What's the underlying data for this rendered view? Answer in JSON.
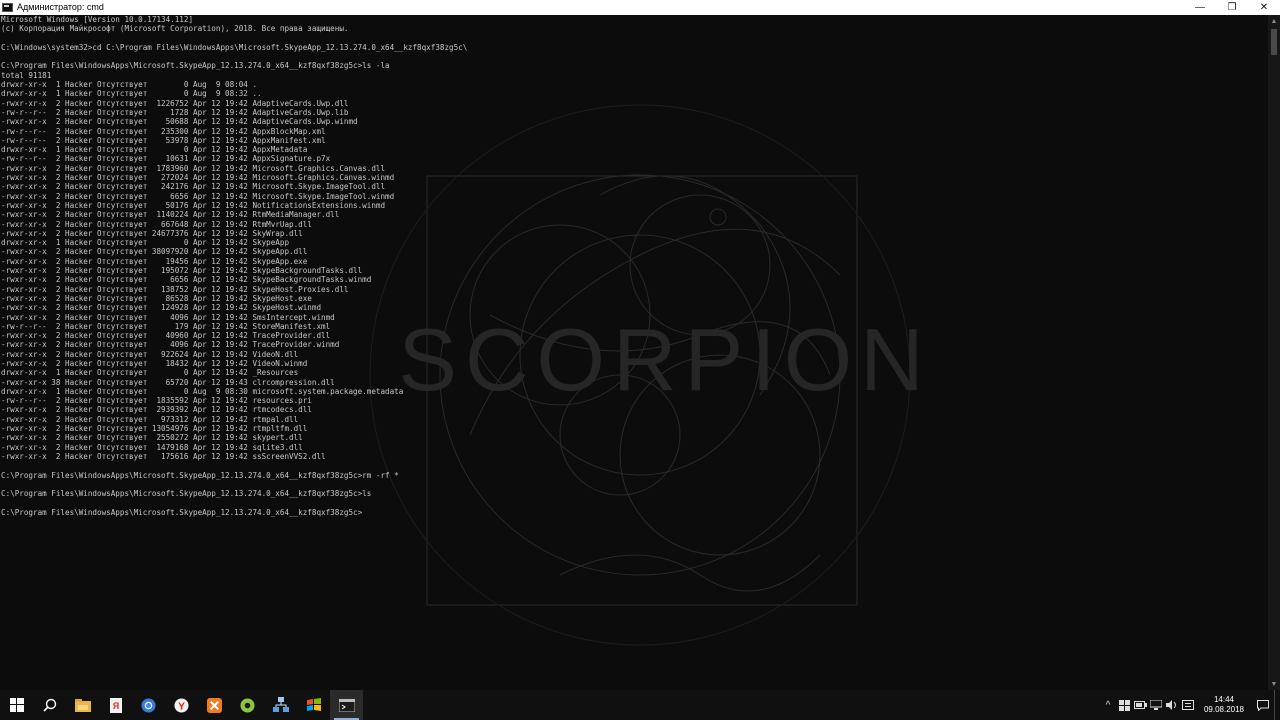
{
  "window": {
    "title": "Администратор: cmd",
    "min_glyph": "—",
    "max_glyph": "❐",
    "close_glyph": "✕"
  },
  "wallpaper": {
    "text": "SCORPION"
  },
  "console": {
    "lines": [
      "Microsoft Windows [Version 10.0.17134.112]",
      "(c) Корпорация Майкрософт (Microsoft Corporation), 2018. Все права защищены.",
      "",
      "C:\\Windows\\system32>cd C:\\Program Files\\WindowsApps\\Microsoft.SkypeApp_12.13.274.0_x64__kzf8qxf38zg5c\\",
      "",
      "C:\\Program Files\\WindowsApps\\Microsoft.SkypeApp_12.13.274.0_x64__kzf8qxf38zg5c>ls -la",
      "total 91181",
      "drwxr-xr-x  1 Hacker Отсутствует        0 Aug  9 08:04 .",
      "drwxr-xr-x  1 Hacker Отсутствует        0 Aug  9 08:32 ..",
      "-rwxr-xr-x  2 Hacker Отсутствует  1226752 Apr 12 19:42 AdaptiveCards.Uwp.dll",
      "-rw-r--r--  2 Hacker Отсутствует     1728 Apr 12 19:42 AdaptiveCards.Uwp.lib",
      "-rwxr-xr-x  2 Hacker Отсутствует    50688 Apr 12 19:42 AdaptiveCards.Uwp.winmd",
      "-rw-r--r--  2 Hacker Отсутствует   235300 Apr 12 19:42 AppxBlockMap.xml",
      "-rw-r--r--  2 Hacker Отсутствует    53978 Apr 12 19:42 AppxManifest.xml",
      "drwxr-xr-x  1 Hacker Отсутствует        0 Apr 12 19:42 AppxMetadata",
      "-rw-r--r--  2 Hacker Отсутствует    10631 Apr 12 19:42 AppxSignature.p7x",
      "-rwxr-xr-x  2 Hacker Отсутствует  1783960 Apr 12 19:42 Microsoft.Graphics.Canvas.dll",
      "-rwxr-xr-x  2 Hacker Отсутствует   272024 Apr 12 19:42 Microsoft.Graphics.Canvas.winmd",
      "-rwxr-xr-x  2 Hacker Отсутствует   242176 Apr 12 19:42 Microsoft.Skype.ImageTool.dll",
      "-rwxr-xr-x  2 Hacker Отсутствует     6656 Apr 12 19:42 Microsoft.Skype.ImageTool.winmd",
      "-rwxr-xr-x  2 Hacker Отсутствует    50176 Apr 12 19:42 NotificationsExtensions.winmd",
      "-rwxr-xr-x  2 Hacker Отсутствует  1140224 Apr 12 19:42 RtmMediaManager.dll",
      "-rwxr-xr-x  2 Hacker Отсутствует   667648 Apr 12 19:42 RtmMvrUap.dll",
      "-rwxr-xr-x  2 Hacker Отсутствует 24677376 Apr 12 19:42 SkyWrap.dll",
      "drwxr-xr-x  1 Hacker Отсутствует        0 Apr 12 19:42 SkypeApp",
      "-rwxr-xr-x  2 Hacker Отсутствует 38097920 Apr 12 19:42 SkypeApp.dll",
      "-rwxr-xr-x  2 Hacker Отсутствует    19456 Apr 12 19:42 SkypeApp.exe",
      "-rwxr-xr-x  2 Hacker Отсутствует   195072 Apr 12 19:42 SkypeBackgroundTasks.dll",
      "-rwxr-xr-x  2 Hacker Отсутствует     6656 Apr 12 19:42 SkypeBackgroundTasks.winmd",
      "-rwxr-xr-x  2 Hacker Отсутствует   138752 Apr 12 19:42 SkypeHost.Proxies.dll",
      "-rwxr-xr-x  2 Hacker Отсутствует    86528 Apr 12 19:42 SkypeHost.exe",
      "-rwxr-xr-x  2 Hacker Отсутствует   124928 Apr 12 19:42 SkypeHost.winmd",
      "-rwxr-xr-x  2 Hacker Отсутствует     4096 Apr 12 19:42 SmsIntercept.winmd",
      "-rw-r--r--  2 Hacker Отсутствует      179 Apr 12 19:42 StoreManifest.xml",
      "-rwxr-xr-x  2 Hacker Отсутствует    40960 Apr 12 19:42 TraceProvider.dll",
      "-rwxr-xr-x  2 Hacker Отсутствует     4096 Apr 12 19:42 TraceProvider.winmd",
      "-rwxr-xr-x  2 Hacker Отсутствует   922624 Apr 12 19:42 VideoN.dll",
      "-rwxr-xr-x  2 Hacker Отсутствует    18432 Apr 12 19:42 VideoN.winmd",
      "drwxr-xr-x  1 Hacker Отсутствует        0 Apr 12 19:42 _Resources",
      "-rwxr-xr-x 38 Hacker Отсутствует    65720 Apr 12 19:43 clrcompression.dll",
      "drwxr-xr-x  1 Hacker Отсутствует        0 Aug  9 08:30 microsoft.system.package.metadata",
      "-rw-r--r--  2 Hacker Отсутствует  1835592 Apr 12 19:42 resources.pri",
      "-rwxr-xr-x  2 Hacker Отсутствует  2939392 Apr 12 19:42 rtmcodecs.dll",
      "-rwxr-xr-x  2 Hacker Отсутствует   973312 Apr 12 19:42 rtmpal.dll",
      "-rwxr-xr-x  2 Hacker Отсутствует 13054976 Apr 12 19:42 rtmpltfm.dll",
      "-rwxr-xr-x  2 Hacker Отсутствует  2550272 Apr 12 19:42 skypert.dll",
      "-rwxr-xr-x  2 Hacker Отсутствует  1479168 Apr 12 19:42 sqlite3.dll",
      "-rwxr-xr-x  2 Hacker Отсутствует   175616 Apr 12 19:42 ssScreenVVS2.dll",
      "",
      "C:\\Program Files\\WindowsApps\\Microsoft.SkypeApp_12.13.274.0_x64__kzf8qxf38zg5c>rm -rf *",
      "",
      "C:\\Program Files\\WindowsApps\\Microsoft.SkypeApp_12.13.274.0_x64__kzf8qxf38zg5c>ls",
      "",
      "C:\\Program Files\\WindowsApps\\Microsoft.SkypeApp_12.13.274.0_x64__kzf8qxf38zg5c>"
    ]
  },
  "taskbar": {
    "apps": [
      {
        "name": "start",
        "icon": "windows-logo-icon"
      },
      {
        "name": "search",
        "icon": "search-icon"
      },
      {
        "name": "file-explorer",
        "icon": "folder-icon"
      },
      {
        "name": "yandex-docs",
        "icon": "document-icon"
      },
      {
        "name": "chrome",
        "icon": "chrome-icon"
      },
      {
        "name": "yandex-browser",
        "icon": "yandex-browser-icon"
      },
      {
        "name": "xampp",
        "icon": "xampp-icon"
      },
      {
        "name": "app-green",
        "icon": "green-circle-icon"
      },
      {
        "name": "network-tool",
        "icon": "network-icon"
      },
      {
        "name": "windows-app",
        "icon": "windows-flag-icon"
      },
      {
        "name": "cmd",
        "icon": "cmd-icon"
      }
    ],
    "clock": {
      "time": "14:44",
      "date": "09.08.2018"
    }
  },
  "colors": {
    "console_bg": "#0c0c0c",
    "console_text": "#c8c8c8",
    "taskbar_bg": "#101010",
    "accent": "#8fb0d8"
  }
}
